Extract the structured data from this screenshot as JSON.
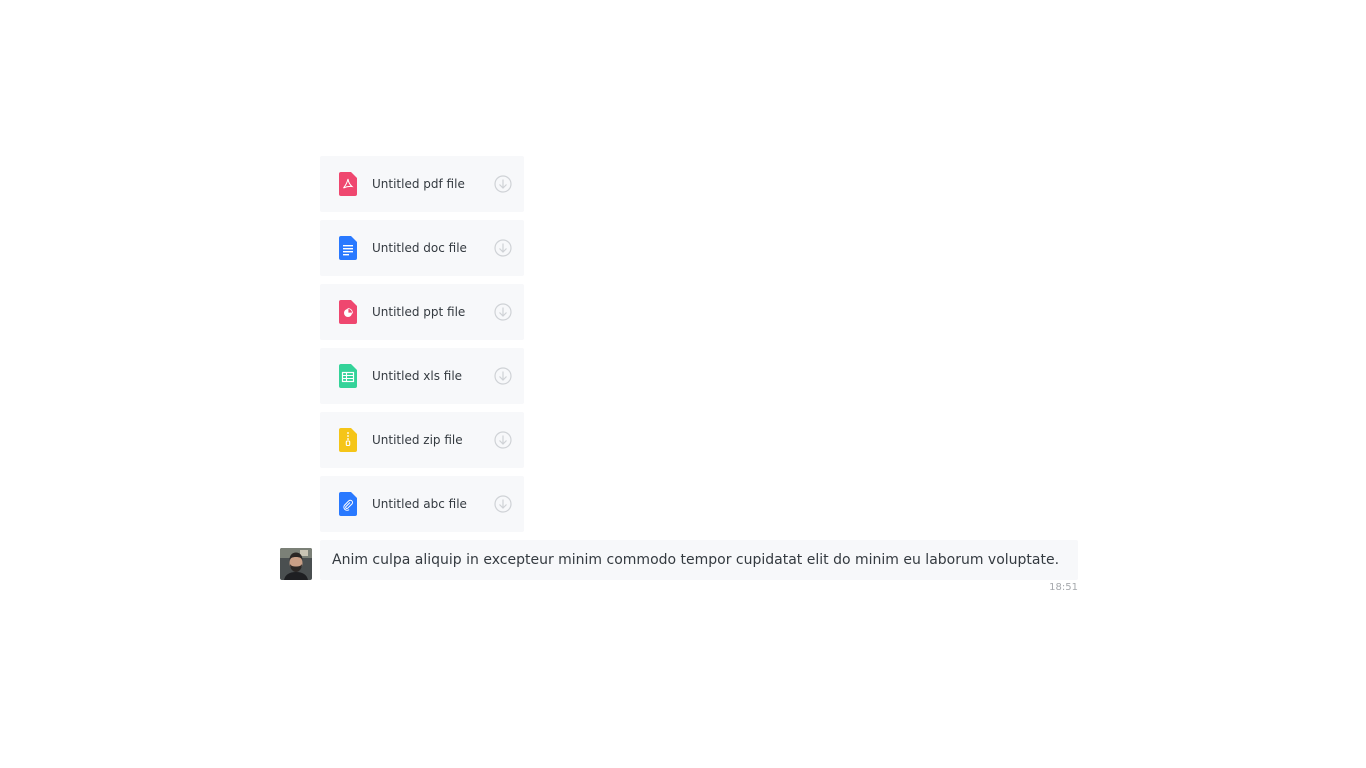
{
  "attachments": [
    {
      "name": "Untitled pdf file",
      "type": "pdf",
      "icon": "pdf-file-icon",
      "color": "#ef476f"
    },
    {
      "name": "Untitled doc file",
      "type": "doc",
      "icon": "doc-file-icon",
      "color": "#2979ff"
    },
    {
      "name": "Untitled ppt file",
      "type": "ppt",
      "icon": "ppt-file-icon",
      "color": "#ef476f"
    },
    {
      "name": "Untitled xls file",
      "type": "xls",
      "icon": "xls-file-icon",
      "color": "#34d399"
    },
    {
      "name": "Untitled zip file",
      "type": "zip",
      "icon": "zip-file-icon",
      "color": "#fbbf24"
    },
    {
      "name": "Untitled abc file",
      "type": "abc",
      "icon": "generic-file-icon",
      "color": "#2979ff"
    }
  ],
  "message": {
    "text": "Anim culpa aliquip in excepteur minim commodo tempor cupidatat elit do minim eu laborum voluptate.",
    "time": "18:51"
  },
  "colors": {
    "bubble_bg": "#f7f8fa",
    "text": "#343a40",
    "muted": "#a6a9ad"
  }
}
